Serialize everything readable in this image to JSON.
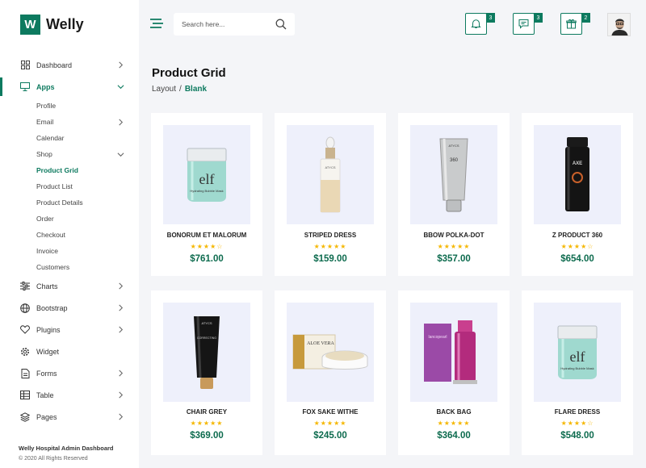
{
  "brand": {
    "mark": "W",
    "name": "Welly"
  },
  "colors": {
    "accent": "#0d7a5f",
    "price": "#0d6b4e",
    "star": "#f5b700"
  },
  "sidebar": {
    "items": [
      {
        "label": "Dashboard",
        "icon": "dashboard-icon",
        "chevron": "right"
      },
      {
        "label": "Apps",
        "icon": "monitor-icon",
        "chevron": "down",
        "active": true
      },
      {
        "label": "Charts",
        "icon": "sliders-icon",
        "chevron": "right"
      },
      {
        "label": "Bootstrap",
        "icon": "globe-icon",
        "chevron": "right"
      },
      {
        "label": "Plugins",
        "icon": "heart-icon",
        "chevron": "right"
      },
      {
        "label": "Widget",
        "icon": "gear-icon"
      },
      {
        "label": "Forms",
        "icon": "file-icon",
        "chevron": "right"
      },
      {
        "label": "Table",
        "icon": "table-icon",
        "chevron": "right"
      },
      {
        "label": "Pages",
        "icon": "layers-icon",
        "chevron": "right"
      }
    ],
    "apps_sub": [
      {
        "label": "Profile"
      },
      {
        "label": "Email",
        "chevron": "right"
      },
      {
        "label": "Calendar"
      },
      {
        "label": "Shop",
        "chevron": "down"
      },
      {
        "label": "Product Grid",
        "active": true
      },
      {
        "label": "Product List"
      },
      {
        "label": "Product Details"
      },
      {
        "label": "Order"
      },
      {
        "label": "Checkout"
      },
      {
        "label": "Invoice"
      },
      {
        "label": "Customers"
      }
    ],
    "footer_title": "Welly Hospital Admin Dashboard",
    "footer_copy": "© 2020 All Rights Reserved"
  },
  "header": {
    "search_placeholder": "Search here...",
    "badges": {
      "notifications": "3",
      "messages": "3",
      "gifts": "2"
    }
  },
  "page": {
    "title": "Product Grid",
    "breadcrumb": {
      "parent": "Layout",
      "separator": "/",
      "current": "Blank"
    }
  },
  "products": [
    {
      "name": "BONORUM ET MALORUM",
      "rating": 3.5,
      "stars": "★★★★☆",
      "price": "$761.00",
      "image": "jar-icon"
    },
    {
      "name": "STRIPED DRESS",
      "rating": 5,
      "stars": "★★★★★",
      "price": "$159.00",
      "image": "dropper-bottle-icon"
    },
    {
      "name": "BBOW POLKA-DOT",
      "rating": 5,
      "stars": "★★★★★",
      "price": "$357.00",
      "image": "tube-icon"
    },
    {
      "name": "Z PRODUCT 360",
      "rating": 3.5,
      "stars": "★★★★☆",
      "price": "$654.00",
      "image": "spray-can-icon"
    },
    {
      "name": "CHAIR GREY",
      "rating": 5,
      "stars": "★★★★★",
      "price": "$369.00",
      "image": "black-tube-icon"
    },
    {
      "name": "FOX SAKE WITHE",
      "rating": 5,
      "stars": "★★★★★",
      "price": "$245.00",
      "image": "cream-box-icon"
    },
    {
      "name": "BACK BAG",
      "rating": 5,
      "stars": "★★★★★",
      "price": "$364.00",
      "image": "pink-bottle-icon"
    },
    {
      "name": "FLARE DRESS",
      "rating": 3.5,
      "stars": "★★★★☆",
      "price": "$548.00",
      "image": "jar-icon"
    }
  ]
}
